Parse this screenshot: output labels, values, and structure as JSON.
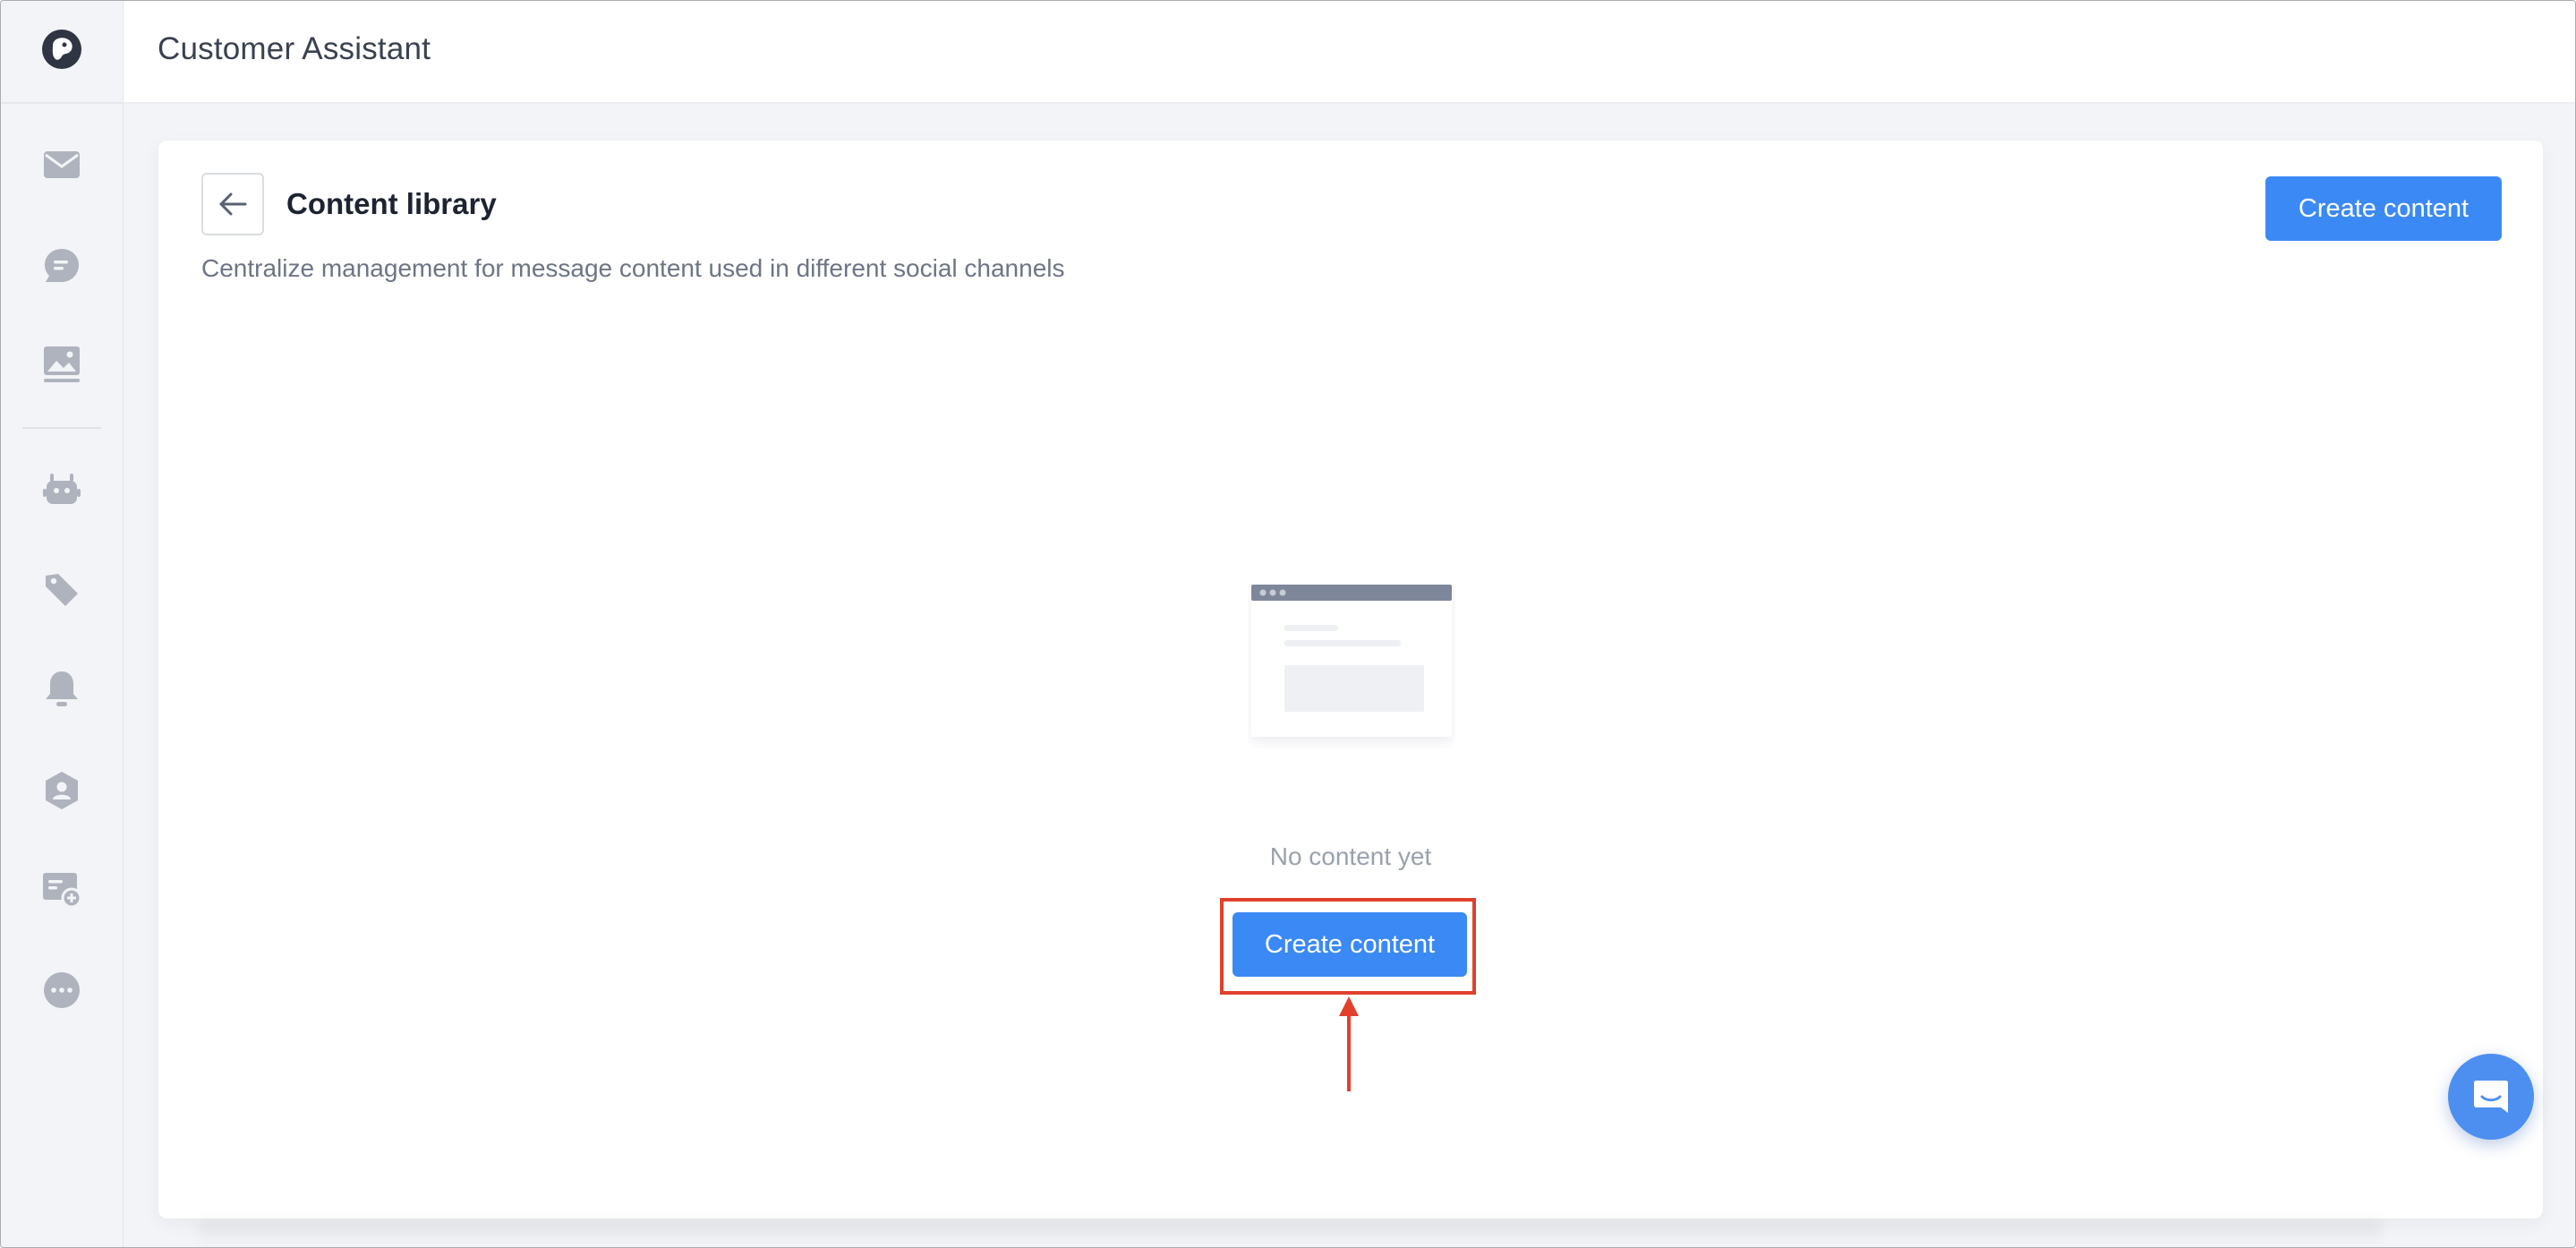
{
  "app": {
    "title": "Customer Assistant"
  },
  "sidebar": {
    "items": [
      {
        "name": "inbox",
        "icon": "envelope-icon"
      },
      {
        "name": "conversations",
        "icon": "chat-bubble-icon"
      },
      {
        "name": "media",
        "icon": "image-gallery-icon"
      },
      {
        "name": "bots",
        "icon": "robot-icon"
      },
      {
        "name": "tags",
        "icon": "tag-icon"
      },
      {
        "name": "notifications",
        "icon": "bell-icon"
      },
      {
        "name": "contacts",
        "icon": "user-shield-icon"
      },
      {
        "name": "message-settings",
        "icon": "message-gear-icon"
      },
      {
        "name": "more",
        "icon": "more-dots-icon"
      }
    ],
    "icon_color": "#aeb3bd"
  },
  "content_library": {
    "title": "Content library",
    "description": "Centralize management for message content used in different social channels",
    "create_button_label": "Create content",
    "empty_state_text": "No content yet",
    "empty_create_button_label": "Create content"
  },
  "colors": {
    "primary": "#3b89f5",
    "highlight": "#e0402c",
    "chat_fab": "#4d8ff0"
  }
}
